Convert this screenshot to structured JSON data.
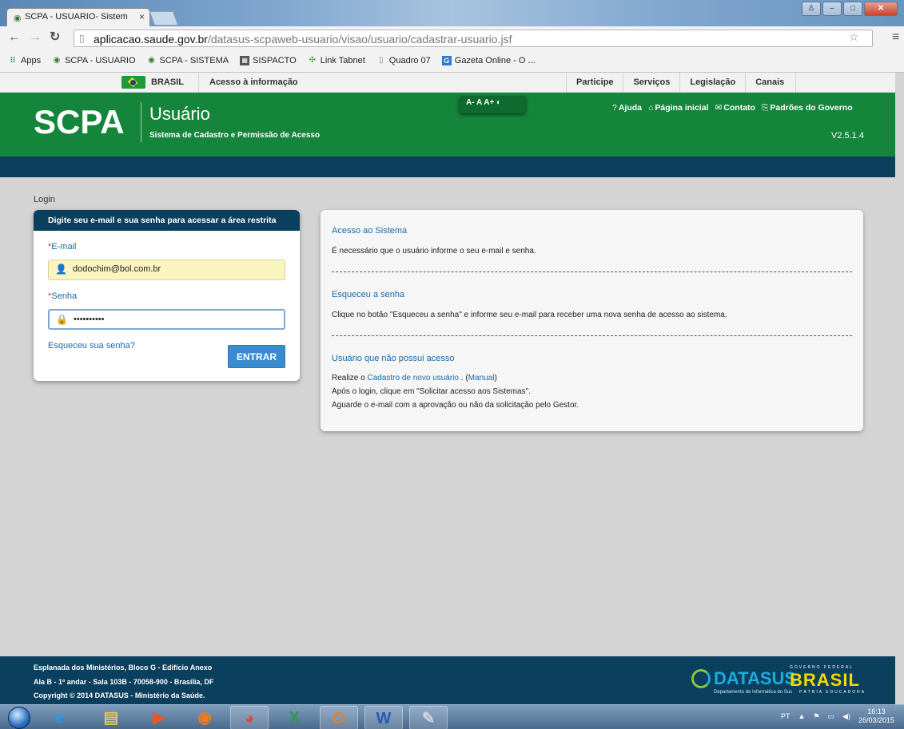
{
  "browser": {
    "tab_title": "SCPA - USUARIO- Sistem",
    "url_host": "aplicacao.saude.gov.br",
    "url_path": "/datasus-scpaweb-usuario/visao/usuario/cadastrar-usuario.jsf",
    "bookmarks": [
      {
        "label": "Apps",
        "icon": "apps-grid-icon"
      },
      {
        "label": "SCPA - USUARIO",
        "icon": "scpa-icon"
      },
      {
        "label": "SCPA - SISTEMA",
        "icon": "scpa-icon"
      },
      {
        "label": "SISPACTO",
        "icon": "sispacto-icon"
      },
      {
        "label": "Link Tabnet",
        "icon": "tabnet-icon"
      },
      {
        "label": "Quadro 07",
        "icon": "page-icon"
      },
      {
        "label": "Gazeta Online - O ...",
        "icon": "gazeta-icon"
      }
    ]
  },
  "govbar": {
    "brasil": "BRASIL",
    "info": "Acesso à informação",
    "links": [
      "Participe",
      "Serviços",
      "Legislação",
      "Canais"
    ]
  },
  "header": {
    "logo": "SCPA",
    "title": "Usuário",
    "subtitle": "Sistema de Cadastro e Permissão de Acesso",
    "font_controls": "A- A A+ ◐",
    "links": [
      {
        "icon": "?",
        "label": "Ajuda"
      },
      {
        "icon": "⌂",
        "label": "Página inicial"
      },
      {
        "icon": "✉",
        "label": "Contato"
      },
      {
        "icon": "⎘",
        "label": "Padrões do Governo"
      }
    ],
    "version": "V2.5.1.4"
  },
  "main": {
    "breadcrumb": "Login",
    "login": {
      "heading": "Digite seu e-mail e sua senha para acessar a área restrita",
      "email_label": "E-mail",
      "email_value": "dodochim@bol.com.br",
      "password_label": "Senha",
      "password_value": "••••••••••",
      "required_mark": "*",
      "forgot": "Esqueceu sua senha?",
      "submit": "ENTRAR"
    },
    "info": {
      "s1_title": "Acesso ao Sistema",
      "s1_text": "É necessário que o usuário informe o seu e-mail e senha.",
      "s2_title": "Esqueceu a senha",
      "s2_text": "Clique no botão \"Esqueceu a senha\" e informe seu e-mail para receber uma nova senha de acesso ao sistema.",
      "s3_title": "Usuário que não possui acesso",
      "s3_pre": "Realize o ",
      "s3_link": "Cadastro de novo usuário",
      "s3_mid": " . (",
      "s3_manual": "Manual",
      "s3_post": ")",
      "s3_line2": "Após o login, clique em \"Solicitar acesso aos Sistemas\".",
      "s3_line3": "Aguarde o e-mail com a aprovação ou não da solicitação pelo Gestor."
    }
  },
  "footer": {
    "line1": "Esplanada dos Ministérios, Bloco G - Edifício Anexo",
    "line2": "Ala B - 1º andar - Sala 103B - 70058-900 - Brasília, DF",
    "line3": "Copyright © 2014 DATASUS - Ministério da Saúde.",
    "datasus": "DATASUS",
    "datasus_sub": "Departamento de Informática do Sus",
    "gov_top": "GOVERNO FEDERAL",
    "gov_brasil": "BRASIL",
    "gov_bottom": "PÁTRIA EDUCADORA"
  },
  "taskbar": {
    "lang": "PT",
    "time": "16:13",
    "date": "26/03/2015"
  },
  "colors": {
    "header_green": "#14853b",
    "navy": "#0b3f5e",
    "link_blue": "#1a6aa8",
    "button_blue": "#3a8bd0"
  }
}
